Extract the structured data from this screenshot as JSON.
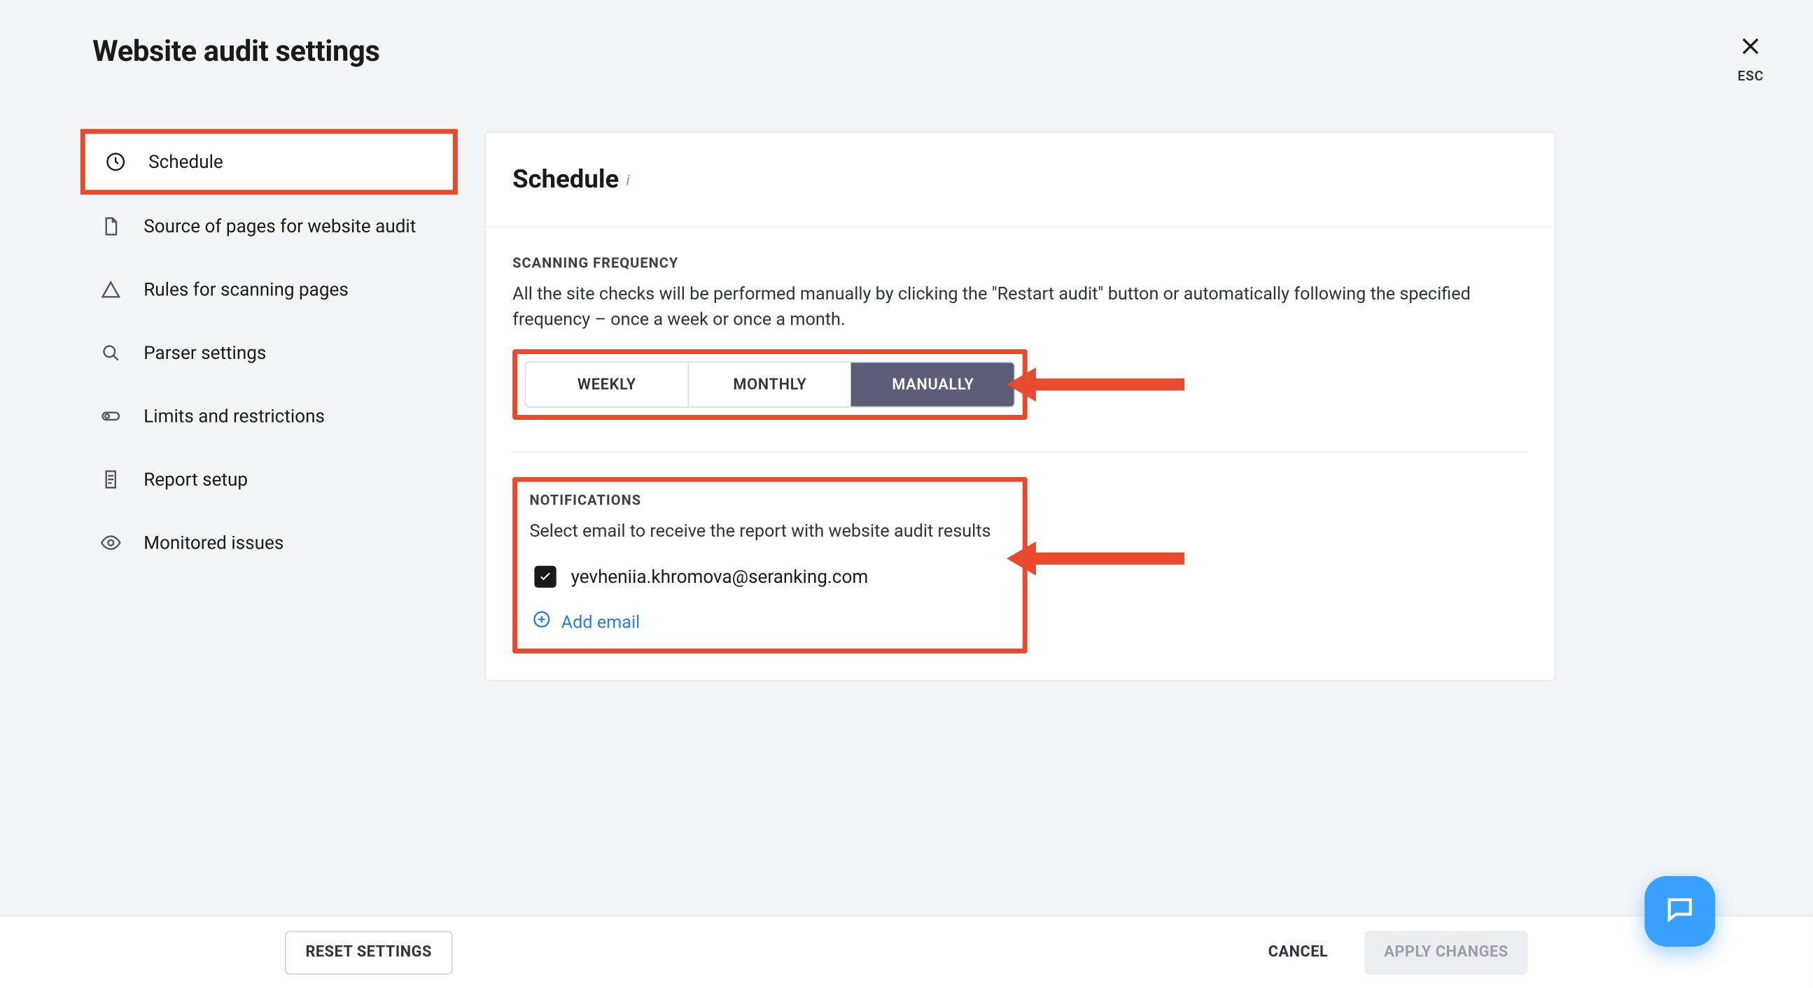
{
  "header": {
    "title": "Website audit settings",
    "esc": "ESC"
  },
  "sidebar": {
    "items": [
      {
        "label": "Schedule"
      },
      {
        "label": "Source of pages for website audit"
      },
      {
        "label": "Rules for scanning pages"
      },
      {
        "label": "Parser settings"
      },
      {
        "label": "Limits and restrictions"
      },
      {
        "label": "Report setup"
      },
      {
        "label": "Monitored issues"
      }
    ]
  },
  "panel": {
    "title": "Schedule",
    "info": "i",
    "freq": {
      "label": "SCANNING FREQUENCY",
      "desc": "All the site checks will be performed manually by clicking the \"Restart audit\" button or automatically following the specified frequency – once a week or once a month.",
      "options": {
        "weekly": "WEEKLY",
        "monthly": "MONTHLY",
        "manually": "MANUALLY"
      },
      "active": "manually"
    },
    "notif": {
      "label": "NOTIFICATIONS",
      "desc": "Select email to receive the report with website audit results",
      "emails": [
        {
          "address": "yevheniia.khromova@seranking.com",
          "checked": true
        }
      ],
      "add_label": "Add email"
    }
  },
  "footer": {
    "reset": "RESET SETTINGS",
    "cancel": "CANCEL",
    "apply": "APPLY CHANGES"
  },
  "colors": {
    "highlight": "#e84a2e",
    "segActive": "#5b5e76",
    "link": "#2b7de1",
    "fab": "#3aa0ff"
  }
}
